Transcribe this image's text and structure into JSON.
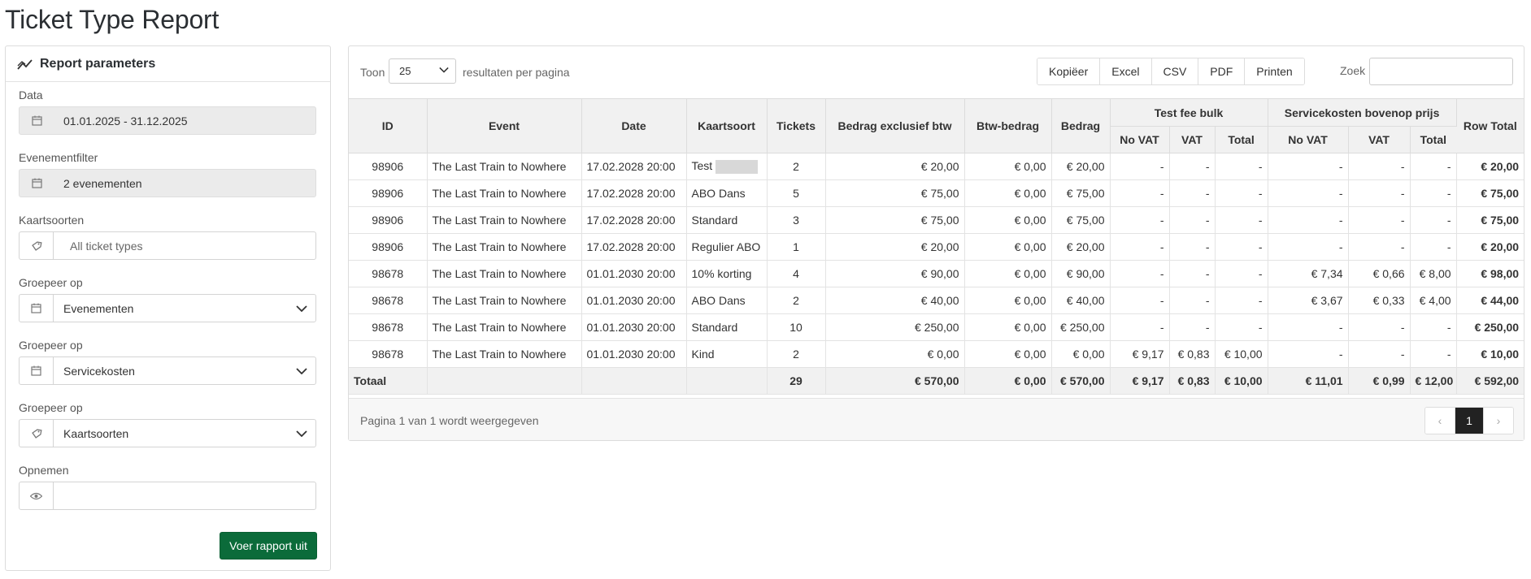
{
  "page": {
    "title": "Ticket Type Report"
  },
  "params": {
    "title": "Report parameters",
    "data_label": "Data",
    "date_range": "01.01.2025 - 31.12.2025",
    "event_filter_label": "Evenementfilter",
    "event_filter_value": "2 evenementen",
    "ticket_types_label": "Kaartsoorten",
    "ticket_types_placeholder": "All ticket types",
    "group1_label": "Groepeer op",
    "group1_value": "Evenementen",
    "group2_label": "Groepeer op",
    "group2_value": "Servicekosten",
    "group3_label": "Groepeer op",
    "group3_value": "Kaartsoorten",
    "include_label": "Opnemen",
    "include_value": "",
    "run_button": "Voer rapport uit"
  },
  "toolbar": {
    "show_label": "Toon",
    "page_length": "25",
    "per_page_label": "resultaten per pagina",
    "buttons": [
      "Kopiëer",
      "Excel",
      "CSV",
      "PDF",
      "Printen"
    ],
    "search_label": "Zoek",
    "search_value": ""
  },
  "table": {
    "headers": {
      "id": "ID",
      "event": "Event",
      "date": "Date",
      "ticket_type": "Kaartsoort",
      "tickets": "Tickets",
      "excl_vat": "Bedrag exclusief btw",
      "vat_amount": "Btw-bedrag",
      "amount": "Bedrag",
      "fee_group": "Test fee bulk",
      "service_group": "Servicekosten bovenop prijs",
      "no_vat": "No VAT",
      "vat": "VAT",
      "total": "Total",
      "row_total": "Row Total"
    },
    "rows": [
      {
        "id": "98906",
        "event": "The Last Train to Nowhere",
        "date": "17.02.2028 20:00",
        "type": "Test",
        "redacted": true,
        "tickets": "2",
        "excl": "€ 20,00",
        "vat": "€ 0,00",
        "amount": "€ 20,00",
        "f_novat": "-",
        "f_vat": "-",
        "f_total": "-",
        "s_novat": "-",
        "s_vat": "-",
        "s_total": "-",
        "row_total": "€ 20,00"
      },
      {
        "id": "98906",
        "event": "The Last Train to Nowhere",
        "date": "17.02.2028 20:00",
        "type": "ABO Dans",
        "tickets": "5",
        "excl": "€ 75,00",
        "vat": "€ 0,00",
        "amount": "€ 75,00",
        "f_novat": "-",
        "f_vat": "-",
        "f_total": "-",
        "s_novat": "-",
        "s_vat": "-",
        "s_total": "-",
        "row_total": "€ 75,00"
      },
      {
        "id": "98906",
        "event": "The Last Train to Nowhere",
        "date": "17.02.2028 20:00",
        "type": "Standard",
        "tickets": "3",
        "excl": "€ 75,00",
        "vat": "€ 0,00",
        "amount": "€ 75,00",
        "f_novat": "-",
        "f_vat": "-",
        "f_total": "-",
        "s_novat": "-",
        "s_vat": "-",
        "s_total": "-",
        "row_total": "€ 75,00"
      },
      {
        "id": "98906",
        "event": "The Last Train to Nowhere",
        "date": "17.02.2028 20:00",
        "type": "Regulier ABO",
        "tickets": "1",
        "excl": "€ 20,00",
        "vat": "€ 0,00",
        "amount": "€ 20,00",
        "f_novat": "-",
        "f_vat": "-",
        "f_total": "-",
        "s_novat": "-",
        "s_vat": "-",
        "s_total": "-",
        "row_total": "€ 20,00"
      },
      {
        "id": "98678",
        "event": "The Last Train to Nowhere",
        "date": "01.01.2030 20:00",
        "type": "10% korting",
        "tickets": "4",
        "excl": "€ 90,00",
        "vat": "€ 0,00",
        "amount": "€ 90,00",
        "f_novat": "-",
        "f_vat": "-",
        "f_total": "-",
        "s_novat": "€ 7,34",
        "s_vat": "€ 0,66",
        "s_total": "€ 8,00",
        "row_total": "€ 98,00"
      },
      {
        "id": "98678",
        "event": "The Last Train to Nowhere",
        "date": "01.01.2030 20:00",
        "type": "ABO Dans",
        "tickets": "2",
        "excl": "€ 40,00",
        "vat": "€ 0,00",
        "amount": "€ 40,00",
        "f_novat": "-",
        "f_vat": "-",
        "f_total": "-",
        "s_novat": "€ 3,67",
        "s_vat": "€ 0,33",
        "s_total": "€ 4,00",
        "row_total": "€ 44,00"
      },
      {
        "id": "98678",
        "event": "The Last Train to Nowhere",
        "date": "01.01.2030 20:00",
        "type": "Standard",
        "tickets": "10",
        "excl": "€ 250,00",
        "vat": "€ 0,00",
        "amount": "€ 250,00",
        "f_novat": "-",
        "f_vat": "-",
        "f_total": "-",
        "s_novat": "-",
        "s_vat": "-",
        "s_total": "-",
        "row_total": "€ 250,00"
      },
      {
        "id": "98678",
        "event": "The Last Train to Nowhere",
        "date": "01.01.2030 20:00",
        "type": "Kind",
        "tickets": "2",
        "excl": "€ 0,00",
        "vat": "€ 0,00",
        "amount": "€ 0,00",
        "f_novat": "€ 9,17",
        "f_vat": "€ 0,83",
        "f_total": "€ 10,00",
        "s_novat": "-",
        "s_vat": "-",
        "s_total": "-",
        "row_total": "€ 10,00"
      }
    ],
    "totals": {
      "label": "Totaal",
      "tickets": "29",
      "excl": "€ 570,00",
      "vat": "€ 0,00",
      "amount": "€ 570,00",
      "f_novat": "€ 9,17",
      "f_vat": "€ 0,83",
      "f_total": "€ 10,00",
      "s_novat": "€ 11,01",
      "s_vat": "€ 0,99",
      "s_total": "€ 12,00",
      "row_total": "€ 592,00"
    }
  },
  "footer": {
    "page_info": "Pagina 1 van 1 wordt weergegeven",
    "prev": "‹",
    "current_page": "1",
    "next": "›"
  },
  "colors": {
    "run_button": "#0b6b3a",
    "header_bg": "#f1f1f1",
    "active_page": "#222222"
  }
}
